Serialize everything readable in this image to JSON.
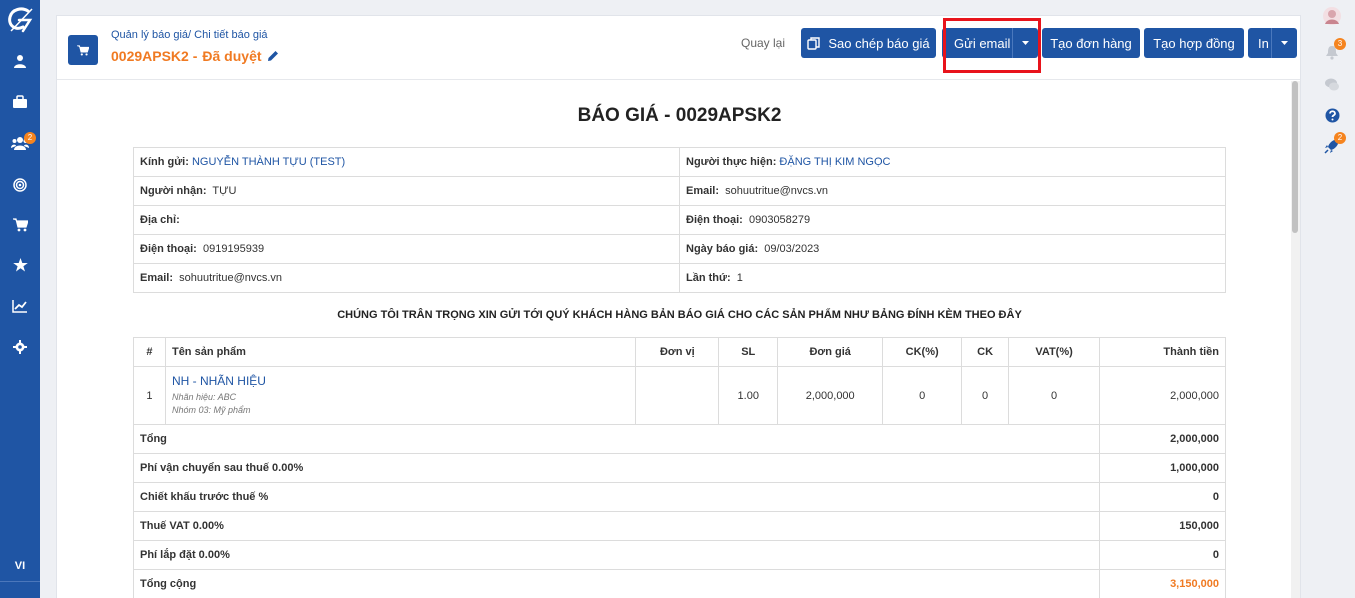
{
  "sidebar": {
    "items": [
      {
        "name": "user-icon",
        "badge": ""
      },
      {
        "name": "briefcase-icon",
        "badge": ""
      },
      {
        "name": "group-icon",
        "badge": "2"
      },
      {
        "name": "target-icon",
        "badge": ""
      },
      {
        "name": "cart-icon",
        "badge": ""
      },
      {
        "name": "star-icon",
        "badge": ""
      },
      {
        "name": "chart-line-icon",
        "badge": ""
      },
      {
        "name": "gear-icon",
        "badge": ""
      }
    ],
    "language": "VI"
  },
  "rail": {
    "notifications_badge": "3",
    "rocket_badge": "2"
  },
  "header": {
    "breadcrumb": "Quản lý báo giá/ Chi tiết báo giá",
    "code": "0029APSK2 -",
    "status": "Đã duyệt",
    "back": "Quay lại",
    "buttons": {
      "copy": "Sao chép báo giá",
      "send_email": "Gửi email",
      "create_order": "Tạo đơn hàng",
      "create_contract": "Tạo hợp đồng",
      "print": "In"
    }
  },
  "quote": {
    "title": "BÁO GIÁ - 0029APSK2",
    "info": {
      "to_label": "Kính gửi:",
      "to_value": "NGUYỄN THÀNH TỰU (TEST)",
      "performer_label": "Người thực hiện:",
      "performer_value": "ĐẶNG THỊ KIM NGỌC",
      "recipient_label": "Người nhận:",
      "recipient_value": "TỰU",
      "email_right_label": "Email:",
      "email_right_value": "sohuutritue@nvcs.vn",
      "address_label": "Địa chỉ:",
      "address_value": "",
      "phone_right_label": "Điện thoại:",
      "phone_right_value": "0903058279",
      "phone_label": "Điện thoại:",
      "phone_value": "0919195939",
      "date_label": "Ngày báo giá:",
      "date_value": "09/03/2023",
      "email_label": "Email:",
      "email_value": "sohuutritue@nvcs.vn",
      "times_label": "Lần thứ:",
      "times_value": "1"
    },
    "intro": "CHÚNG TÔI TRÂN TRỌNG XIN GỬI TỚI QUÝ KHÁCH HÀNG BẢN BÁO GIÁ CHO CÁC SẢN PHẨM NHƯ BẢNG ĐÍNH KÈM THEO ĐÂY",
    "columns": {
      "no": "#",
      "product": "Tên sản phẩm",
      "unit": "Đơn vị",
      "qty": "SL",
      "price": "Đơn giá",
      "disc_pct": "CK(%)",
      "disc": "CK",
      "vat": "VAT(%)",
      "total": "Thành tiền"
    },
    "items": [
      {
        "no": "1",
        "name": "NH - NHÃN HIỆU",
        "brand": "Nhãn hiệu: ABC",
        "group": "Nhóm 03: Mỹ phẩm",
        "unit": "",
        "qty": "1.00",
        "price": "2,000,000",
        "disc_pct": "0",
        "disc": "0",
        "vat": "0",
        "total": "2,000,000"
      }
    ],
    "summary": {
      "subtotal_label": "Tổng",
      "subtotal_value": "2,000,000",
      "shipping_label": "Phí vận chuyển sau thuế 0.00%",
      "shipping_value": "1,000,000",
      "discount_label": "Chiết khấu trước thuế %",
      "discount_value": "0",
      "vat_label": "Thuế VAT 0.00%",
      "vat_value": "150,000",
      "install_label": "Phí lắp đặt 0.00%",
      "install_value": "0",
      "grand_label": "Tổng cộng",
      "grand_value": "3,150,000"
    }
  },
  "colors": {
    "primary": "#1f55a4",
    "accent": "#f07a22",
    "highlight": "#e8131b"
  }
}
